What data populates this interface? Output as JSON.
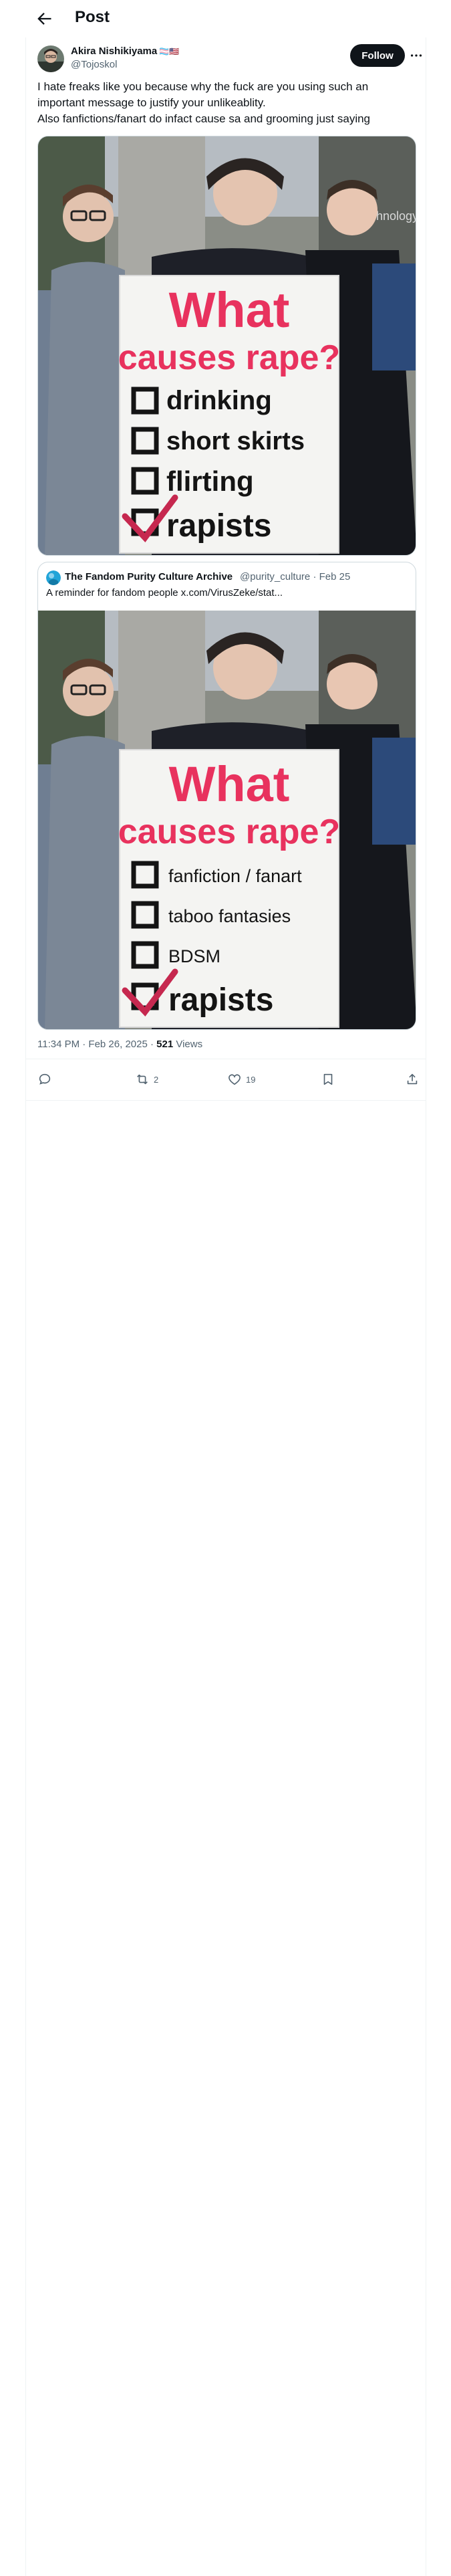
{
  "header": {
    "title": "Post"
  },
  "tweet": {
    "author_name": "Akira Nishikiyama",
    "author_flags": "🏳️‍⚧️🇺🇸",
    "author_handle": "@Tojoskol",
    "follow_label": "Follow",
    "text_lines": [
      "I hate freaks like you because why the fuck are you using such an",
      "important message to justify your unlikeablity.",
      "Also fanfictions/fanart do infact cause sa and grooming just saying"
    ],
    "image": {
      "sign_title_line1": "What",
      "sign_title_line2": "causes rape?",
      "items": [
        "drinking",
        "short skirts",
        "flirting",
        "rapists"
      ],
      "background_text": "Technology"
    },
    "quote": {
      "name": "The Fandom Purity Culture Archive",
      "handle": "@purity_culture",
      "separator": "·",
      "date": "Feb 25",
      "text": "A reminder for fandom people  x.com/VirusZeke/stat...",
      "image": {
        "sign_title_line1": "What",
        "sign_title_line2": "causes rape?",
        "items": [
          "fanfiction / fanart",
          "taboo fantasies",
          "BDSM",
          "rapists"
        ]
      }
    },
    "timestamp": "11:34 PM · Feb 26, 2025 · ",
    "views_count": "521",
    "views_label": " Views",
    "actions": {
      "reply_count": "",
      "retweet_count": "2",
      "like_count": "19"
    }
  },
  "colors": {
    "text": "#0f1419",
    "secondary": "#536471",
    "border": "#cfd9de",
    "sign_red": "#e8325e",
    "check_red": "#c6284f"
  }
}
